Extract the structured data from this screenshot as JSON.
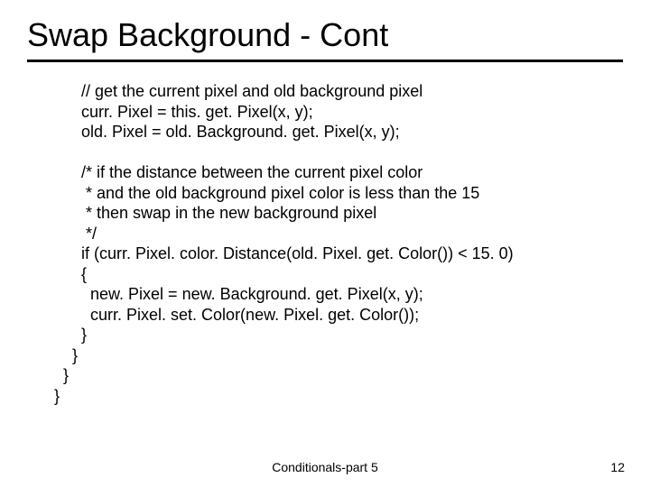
{
  "title": "Swap Background - Cont",
  "code": "      // get the current pixel and old background pixel\n      curr. Pixel = this. get. Pixel(x, y);\n      old. Pixel = old. Background. get. Pixel(x, y);\n\n      /* if the distance between the current pixel color\n       * and the old background pixel color is less than the 15\n       * then swap in the new background pixel\n       */\n      if (curr. Pixel. color. Distance(old. Pixel. get. Color()) < 15. 0)\n      {\n        new. Pixel = new. Background. get. Pixel(x, y);\n        curr. Pixel. set. Color(new. Pixel. get. Color());\n      }\n    }\n  }\n}",
  "footer_center": "Conditionals-part 5",
  "footer_right": "12"
}
